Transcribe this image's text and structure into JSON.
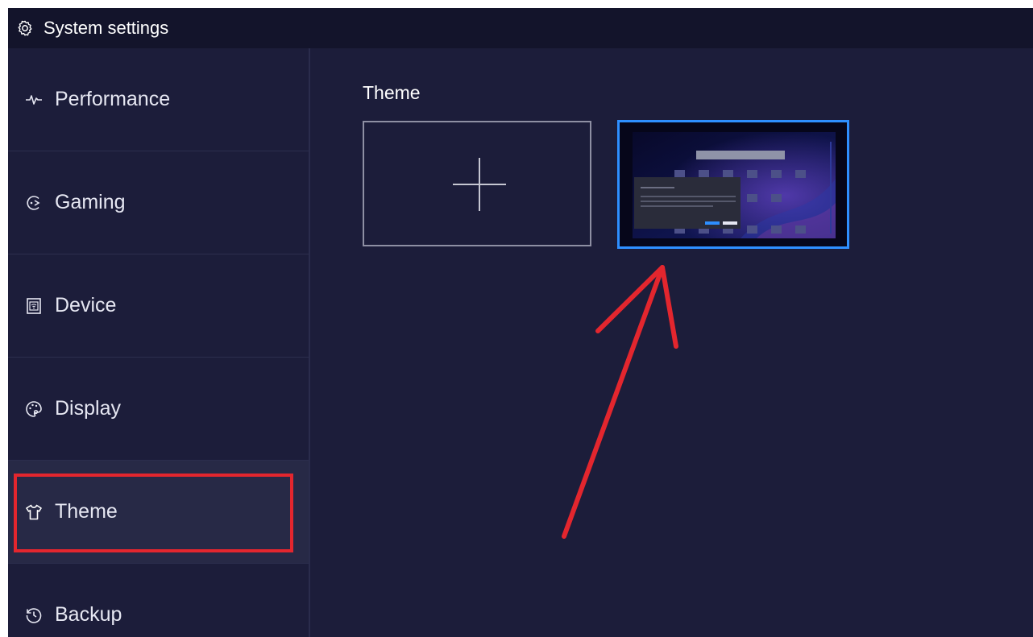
{
  "window": {
    "title": "System settings",
    "title_icon": "gear-icon"
  },
  "sidebar": {
    "items": [
      {
        "label": "Performance",
        "icon": "pulse-icon",
        "active": false
      },
      {
        "label": "Gaming",
        "icon": "gamepad-icon",
        "active": false
      },
      {
        "label": "Device",
        "icon": "device-icon",
        "active": false
      },
      {
        "label": "Display",
        "icon": "palette-icon",
        "active": false
      },
      {
        "label": "Theme",
        "icon": "tshirt-icon",
        "active": true
      },
      {
        "label": "Backup",
        "icon": "history-icon",
        "active": false
      }
    ]
  },
  "main": {
    "section_title": "Theme",
    "tiles": [
      {
        "type": "add",
        "icon": "plus-icon"
      },
      {
        "type": "theme-preview",
        "selected": true
      }
    ]
  },
  "annotations": {
    "highlight_color": "#e3262e",
    "arrow_color": "#e3262e",
    "highlighted_item": "Theme",
    "arrow_target": "theme-preview"
  },
  "colors": {
    "background": "#1c1d3a",
    "titlebar": "#13142b",
    "selected_border": "#2e8fff",
    "active_item": "#272946"
  }
}
